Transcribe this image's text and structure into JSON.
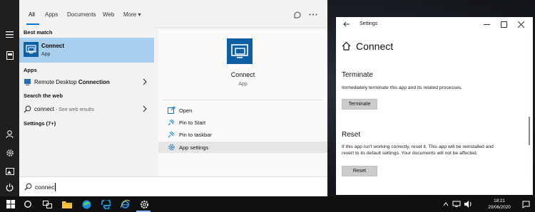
{
  "start_menu": {
    "rail_icons": [
      "menu-icon",
      "home-icon",
      "documents-icon",
      "user-icon",
      "settings-icon",
      "photos-icon",
      "power-icon"
    ],
    "tabs": [
      "All",
      "Apps",
      "Documents",
      "Web",
      "More"
    ],
    "best_match_label": "Best match",
    "best_match": {
      "title": "Connect",
      "subtitle": "App"
    },
    "apps_label": "Apps",
    "apps": [
      {
        "name_prefix": "Remote Desktop ",
        "name_bold": "Connection"
      }
    ],
    "web_label": "Search the web",
    "web": [
      {
        "query": "connect",
        "suffix": " - See web results"
      }
    ],
    "settings_label": "Settings (7+)",
    "detail": {
      "title": "Connect",
      "subtitle": "App",
      "actions": [
        "Open",
        "Pin to Start",
        "Pin to taskbar",
        "App settings"
      ],
      "selected_action_index": 3
    },
    "search": {
      "value": "connect",
      "placeholder": ""
    }
  },
  "settings_window": {
    "window_title": "Settings",
    "page_title": "Connect",
    "terminate": {
      "heading": "Terminate",
      "text": "Immediately terminate this app and its related processes.",
      "button": "Terminate"
    },
    "reset": {
      "heading": "Reset",
      "text1": "If this app isn't working correctly, reset it. This app will be reinstalled and",
      "text2": "revert to its default settings. Your documents will not be affected.",
      "button": "Reset"
    }
  },
  "taskbar": {
    "time": "18:21",
    "date": "20/06/2020",
    "icons": [
      "windows-start-icon",
      "search-icon",
      "task-view-icon",
      "file-explorer-icon",
      "edge-chromium-icon",
      "edge-legacy-icon",
      "internet-explorer-icon",
      "settings-gear-icon"
    ]
  },
  "colors": {
    "accent": "#0078d4",
    "selected_row": "#a9cfee",
    "app_tile": "#0f5fa3"
  }
}
